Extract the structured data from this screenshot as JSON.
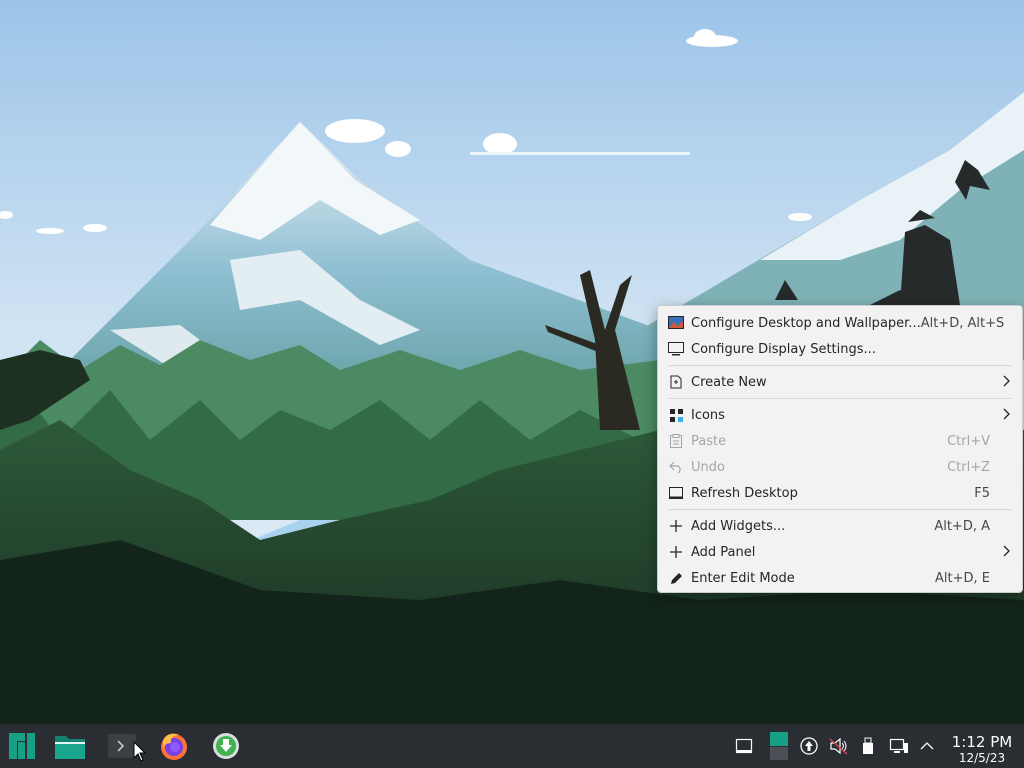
{
  "desktop": {
    "name": "Plasma desktop wallpaper"
  },
  "context_menu": {
    "items": [
      {
        "label": "Configure Desktop and Wallpaper...",
        "shortcut": "Alt+D, Alt+S",
        "icon": "wallpaper-icon"
      },
      {
        "label": "Configure Display Settings...",
        "shortcut": "",
        "icon": "display-icon"
      },
      {
        "label": "Create New",
        "shortcut": "",
        "icon": "create-new-icon",
        "submenu": true
      },
      {
        "label": "Icons",
        "shortcut": "",
        "icon": "icons-grid-icon",
        "submenu": true
      },
      {
        "label": "Paste",
        "shortcut": "Ctrl+V",
        "icon": "paste-icon",
        "disabled": true
      },
      {
        "label": "Undo",
        "shortcut": "Ctrl+Z",
        "icon": "undo-icon",
        "disabled": true
      },
      {
        "label": "Refresh Desktop",
        "shortcut": "F5",
        "icon": "refresh-icon"
      },
      {
        "label": "Add Widgets...",
        "shortcut": "Alt+D, A",
        "icon": "plus-icon"
      },
      {
        "label": "Add Panel",
        "shortcut": "",
        "icon": "plus-icon",
        "submenu": true
      },
      {
        "label": "Enter Edit Mode",
        "shortcut": "Alt+D, E",
        "icon": "edit-icon"
      }
    ]
  },
  "taskbar": {
    "launchers": [
      "manjaro-logo-icon",
      "file-manager-icon",
      "terminal-icon",
      "firefox-icon",
      "download-manager-icon"
    ],
    "tray": [
      "show-desktop-icon",
      "pager-icon",
      "updates-icon",
      "volume-muted-icon",
      "usb-device-icon",
      "network-icon",
      "expand-tray-icon"
    ],
    "clock": {
      "time": "1:12 PM",
      "date": "12/5/23"
    }
  },
  "colors": {
    "accent": "#16a085",
    "taskbar_bg": "#2a2e32",
    "menu_bg": "#f2f2f3"
  }
}
